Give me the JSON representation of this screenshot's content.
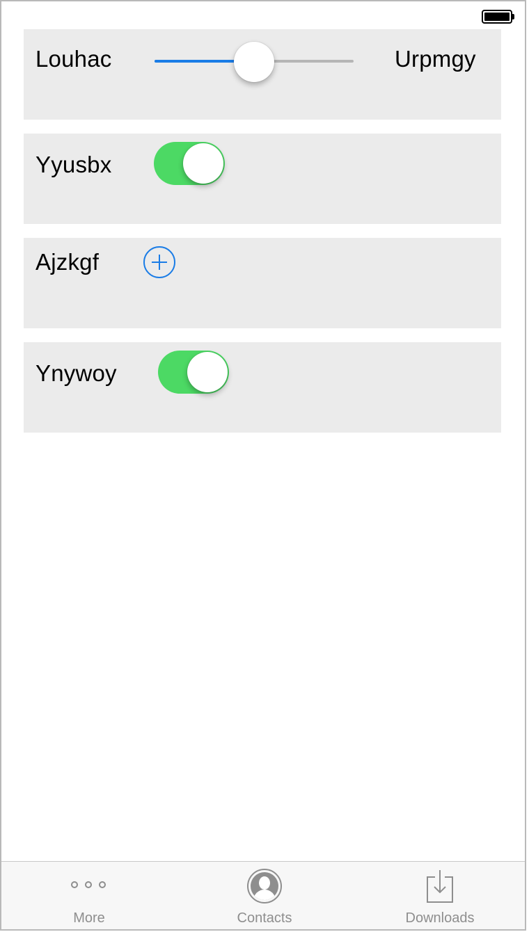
{
  "rows": [
    {
      "label": "Louhac",
      "control": "slider",
      "max_label": "Urpmgy",
      "value_fraction": 0.5
    },
    {
      "label": "Yyusbx",
      "control": "toggle",
      "on": true
    },
    {
      "label": "Ajzkgf",
      "control": "add-button"
    },
    {
      "label": "Ynywoy",
      "control": "toggle",
      "on": true
    }
  ],
  "tabbar": {
    "tabs": [
      {
        "label": "More",
        "icon": "more-dots-icon"
      },
      {
        "label": "Contacts",
        "icon": "contact-icon"
      },
      {
        "label": "Downloads",
        "icon": "download-icon"
      }
    ]
  },
  "colors": {
    "accent": "#1a7ce6",
    "toggle_on": "#4cd964",
    "row_background": "#ebebeb",
    "tab_inactive": "#8e8e8e"
  }
}
